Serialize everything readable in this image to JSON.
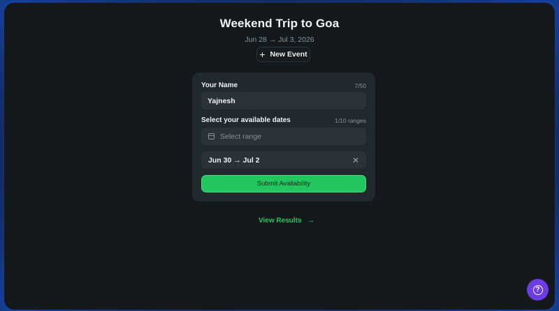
{
  "event": {
    "title": "Weekend Trip to Goa",
    "date_range": "Jun 28 → Jul 3, 2026"
  },
  "new_event_button": {
    "icon": "plus-icon",
    "label": "New Event"
  },
  "form": {
    "name_label": "Your Name",
    "name_count": "7/50",
    "name_value": "Yajnesh",
    "dates_label": "Select your available dates",
    "dates_count": "1/10 ranges",
    "range_placeholder": "Select range",
    "range_icon": "calendar-icon",
    "selected_ranges": [
      {
        "label": "Jun 30 → Jul 2",
        "remove_icon": "close-icon"
      }
    ],
    "submit_label": "Submit Availability"
  },
  "view_results": {
    "label": "View Results",
    "icon": "arrow-right-icon"
  },
  "help_button": {
    "icon": "help-icon",
    "glyph": "?"
  },
  "colors": {
    "accent": "#22c55e",
    "help": "#6d3de3",
    "background": "#15191c",
    "card": "#22292d",
    "glow": "#1b4a9c"
  }
}
